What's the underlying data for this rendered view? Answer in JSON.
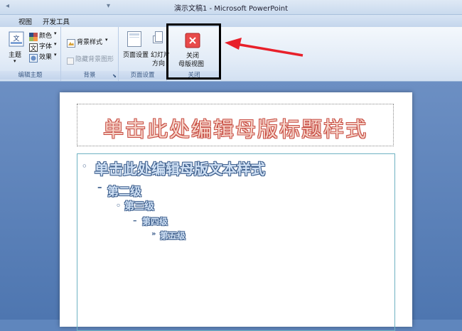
{
  "window": {
    "title": "演示文稿1 - Microsoft PowerPoint"
  },
  "tabs": [
    "视图",
    "开发工具"
  ],
  "ribbon": {
    "edit_theme": {
      "label": "编辑主题",
      "theme_btn": "主题",
      "colors": "颜色",
      "fonts": "字体",
      "effects": "效果"
    },
    "background": {
      "label": "背景",
      "styles": "背景样式",
      "hide": "隐藏背景图形"
    },
    "page_setup": {
      "label": "页面设置",
      "setup": "页面设置",
      "orientation_1": "幻灯片",
      "orientation_2": "方向"
    },
    "close": {
      "label": "关闭",
      "btn_1": "关闭",
      "btn_2": "母版视图"
    }
  },
  "slide": {
    "title": "单击此处编辑母版标题样式",
    "levels": [
      "单击此处编辑母版文本样式",
      "第二级",
      "第三级",
      "第四级",
      "第五级"
    ]
  },
  "colors": {
    "annotation_arrow": "#e8202a",
    "highlight_box": "#000000"
  }
}
